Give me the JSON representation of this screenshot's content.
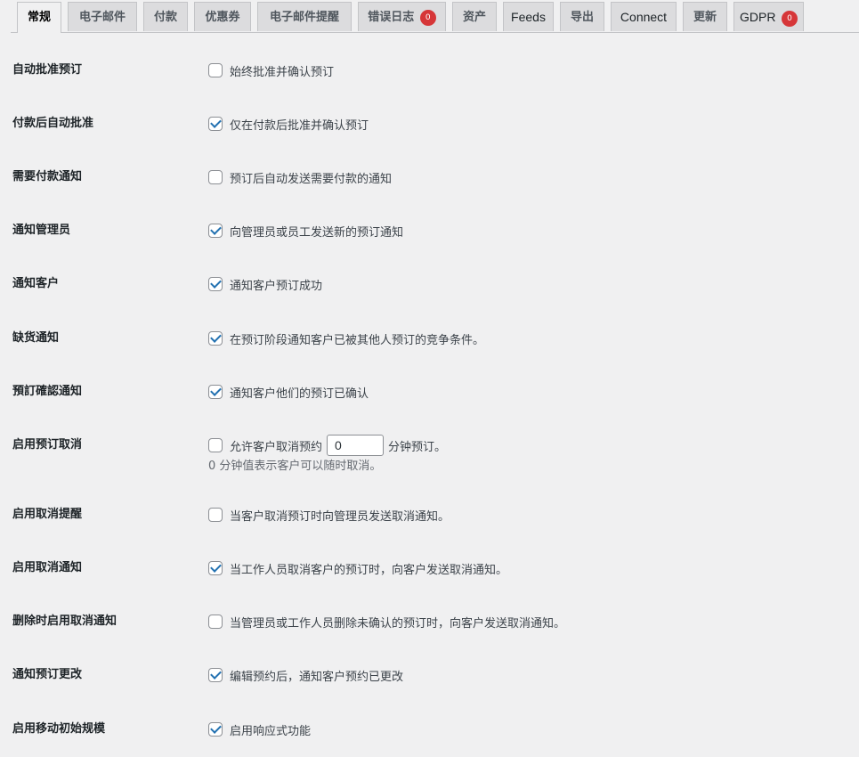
{
  "tabs": [
    {
      "label": "常规",
      "active": true
    },
    {
      "label": "电子邮件"
    },
    {
      "label": "付款"
    },
    {
      "label": "优惠券"
    },
    {
      "label": "电子邮件提醒"
    },
    {
      "label": "错误日志",
      "badge": "0"
    },
    {
      "label": "资产"
    },
    {
      "label": "Feeds"
    },
    {
      "label": "导出"
    },
    {
      "label": "Connect"
    },
    {
      "label": "更新"
    },
    {
      "label": "GDPR",
      "badge": "0"
    }
  ],
  "settings": [
    {
      "label": "自动批准预订",
      "checked": false,
      "description": "始终批准并确认预订"
    },
    {
      "label": "付款后自动批准",
      "checked": true,
      "description": "仅在付款后批准并确认预订"
    },
    {
      "label": "需要付款通知",
      "checked": false,
      "description": "预订后自动发送需要付款的通知"
    },
    {
      "label": "通知管理员",
      "checked": true,
      "description": "向管理员或员工发送新的预订通知"
    },
    {
      "label": "通知客户",
      "checked": true,
      "description": "通知客户预订成功"
    },
    {
      "label": "缺货通知",
      "checked": true,
      "description": "在预订阶段通知客户已被其他人预订的竞争条件。"
    },
    {
      "label": "預訂確認通知",
      "checked": true,
      "description": "通知客户他们的预订已确认"
    },
    {
      "label": "启用预订取消",
      "checked": false,
      "description": "允许客户取消预约",
      "input_value": "0",
      "suffix": "分钟预订。",
      "hint": "0 分钟值表示客户可以随时取消。"
    },
    {
      "label": "启用取消提醒",
      "checked": false,
      "description": "当客户取消预订时向管理员发送取消通知。"
    },
    {
      "label": "启用取消通知",
      "checked": true,
      "description": "当工作人员取消客户的预订时，向客户发送取消通知。"
    },
    {
      "label": "删除时启用取消通知",
      "checked": false,
      "description": "当管理员或工作人员删除未确认的预订时，向客户发送取消通知。"
    },
    {
      "label": "通知预订更改",
      "checked": true,
      "description": "编辑预约后，通知客户预约已更改"
    },
    {
      "label": "启用移动初始规模",
      "checked": true,
      "description": "启用响应式功能"
    }
  ]
}
